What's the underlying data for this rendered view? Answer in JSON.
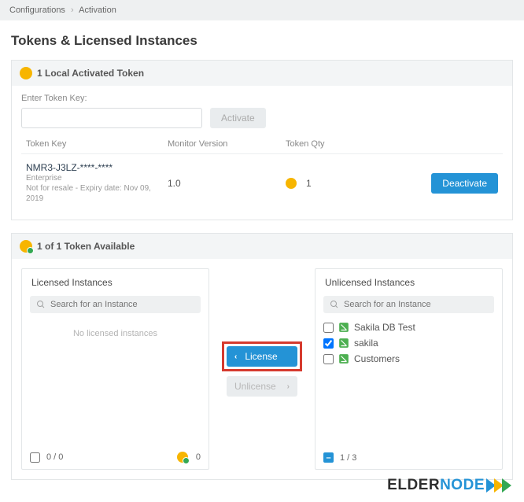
{
  "breadcrumb": {
    "root": "Configurations",
    "current": "Activation"
  },
  "title": "Tokens & Licensed Instances",
  "local_tokens": {
    "heading": "1 Local Activated Token",
    "enter_label": "Enter Token Key:",
    "activate_btn": "Activate",
    "columns": {
      "key": "Token Key",
      "ver": "Monitor Version",
      "qty": "Token Qty"
    },
    "row": {
      "key": "NMR3-J3LZ-****-****",
      "tier": "Enterprise",
      "meta": "Not for resale - Expiry date: Nov 09, 2019",
      "version": "1.0",
      "qty": "1",
      "deactivate": "Deactivate"
    }
  },
  "available": {
    "heading": "1 of 1 Token Available",
    "left": {
      "title": "Licensed Instances",
      "search": "Search for an Instance",
      "empty": "No licensed instances",
      "footer_count": "0 / 0",
      "footer_tokens": "0"
    },
    "mid": {
      "license": "License",
      "unlicense": "Unlicense"
    },
    "right": {
      "title": "Unlicensed Instances",
      "search": "Search for an Instance",
      "items": [
        {
          "name": "Sakila DB Test",
          "checked": false
        },
        {
          "name": "sakila",
          "checked": true
        },
        {
          "name": "Customers",
          "checked": false
        }
      ],
      "footer_count": "1 / 3"
    }
  },
  "logo": {
    "elder": "ELDER",
    "node": "NOD"
  }
}
